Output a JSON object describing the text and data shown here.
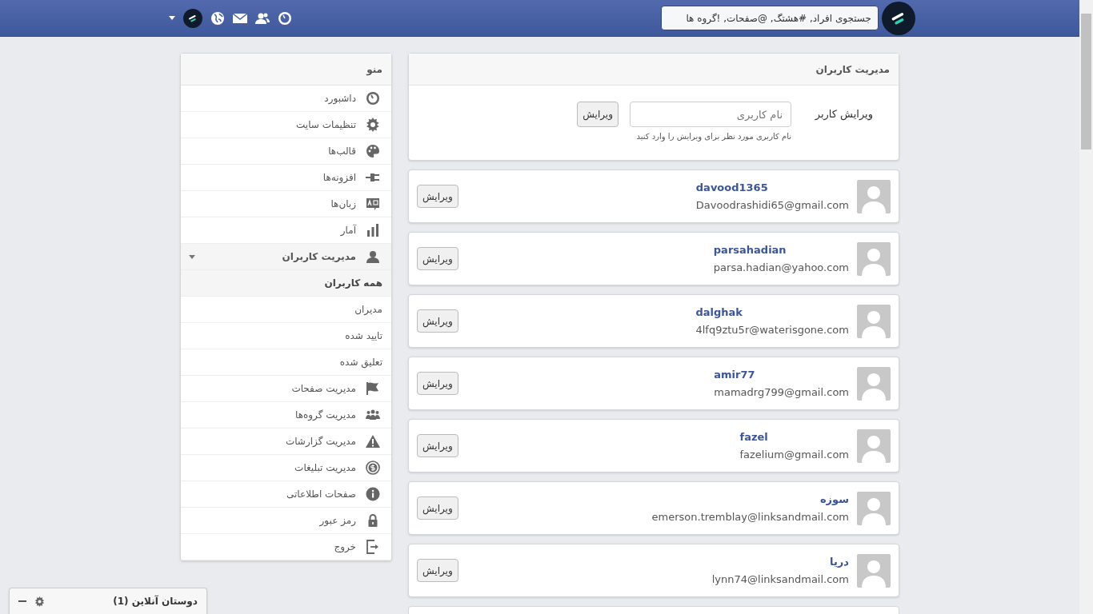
{
  "header": {
    "search": {
      "placeholder": "جستجوی افراد, #هشتگ, @صفحات, !گروه ها"
    }
  },
  "sidebar": {
    "title": "منو",
    "items": [
      {
        "label": "داشبورد"
      },
      {
        "label": "تنظیمات سایت"
      },
      {
        "label": "قالب‌ها"
      },
      {
        "label": "افزونه‌ها"
      },
      {
        "label": "زبان‌ها"
      },
      {
        "label": "آمار"
      },
      {
        "label": "مدیریت کاربران",
        "expanded": true,
        "children": [
          {
            "label": "همه کاربران",
            "selected": true
          },
          {
            "label": "مدیران",
            "selected": false
          },
          {
            "label": "تایید شده",
            "selected": false
          },
          {
            "label": "تعلیق شده",
            "selected": false
          }
        ]
      },
      {
        "label": "مدیریت صفحات"
      },
      {
        "label": "مدیریت گروه‌ها"
      },
      {
        "label": "مدیریت گزارشات"
      },
      {
        "label": "مدیریت تبلیغات"
      },
      {
        "label": "صفحات اطلاعاتی"
      },
      {
        "label": "رمز عبور"
      },
      {
        "label": "خروج"
      }
    ]
  },
  "user_management": {
    "title": "مدیریت کاربران",
    "edit_label": "ویرایش کاربر",
    "username_field": {
      "placeholder": "نام کاربری"
    },
    "edit_button": "ویرایش",
    "help": "نام کاربری مورد نظر برای ویرایش را وارد کنید"
  },
  "users": [
    {
      "username": "davood1365",
      "email": "Davoodrashidi65@gmail.com",
      "button": "ویرایش"
    },
    {
      "username": "parsahadian",
      "email": "parsa.hadian@yahoo.com",
      "button": "ویرایش"
    },
    {
      "username": "dalghak",
      "email": "4lfq9ztu5r@waterisgone.com",
      "button": "ویرایش"
    },
    {
      "username": "amir77",
      "email": "mamadrg799@gmail.com",
      "button": "ویرایش"
    },
    {
      "username": "fazel",
      "email": "fazelium@gmail.com",
      "button": "ویرایش"
    },
    {
      "username": "سوزه",
      "email": "emerson.tremblay@linksandmail.com",
      "button": "ویرایش"
    },
    {
      "username": "دریا",
      "email": "lynn74@linksandmail.com",
      "button": "ویرایش"
    }
  ],
  "online_friends": {
    "title": "دوستان آنلاین (1)"
  }
}
